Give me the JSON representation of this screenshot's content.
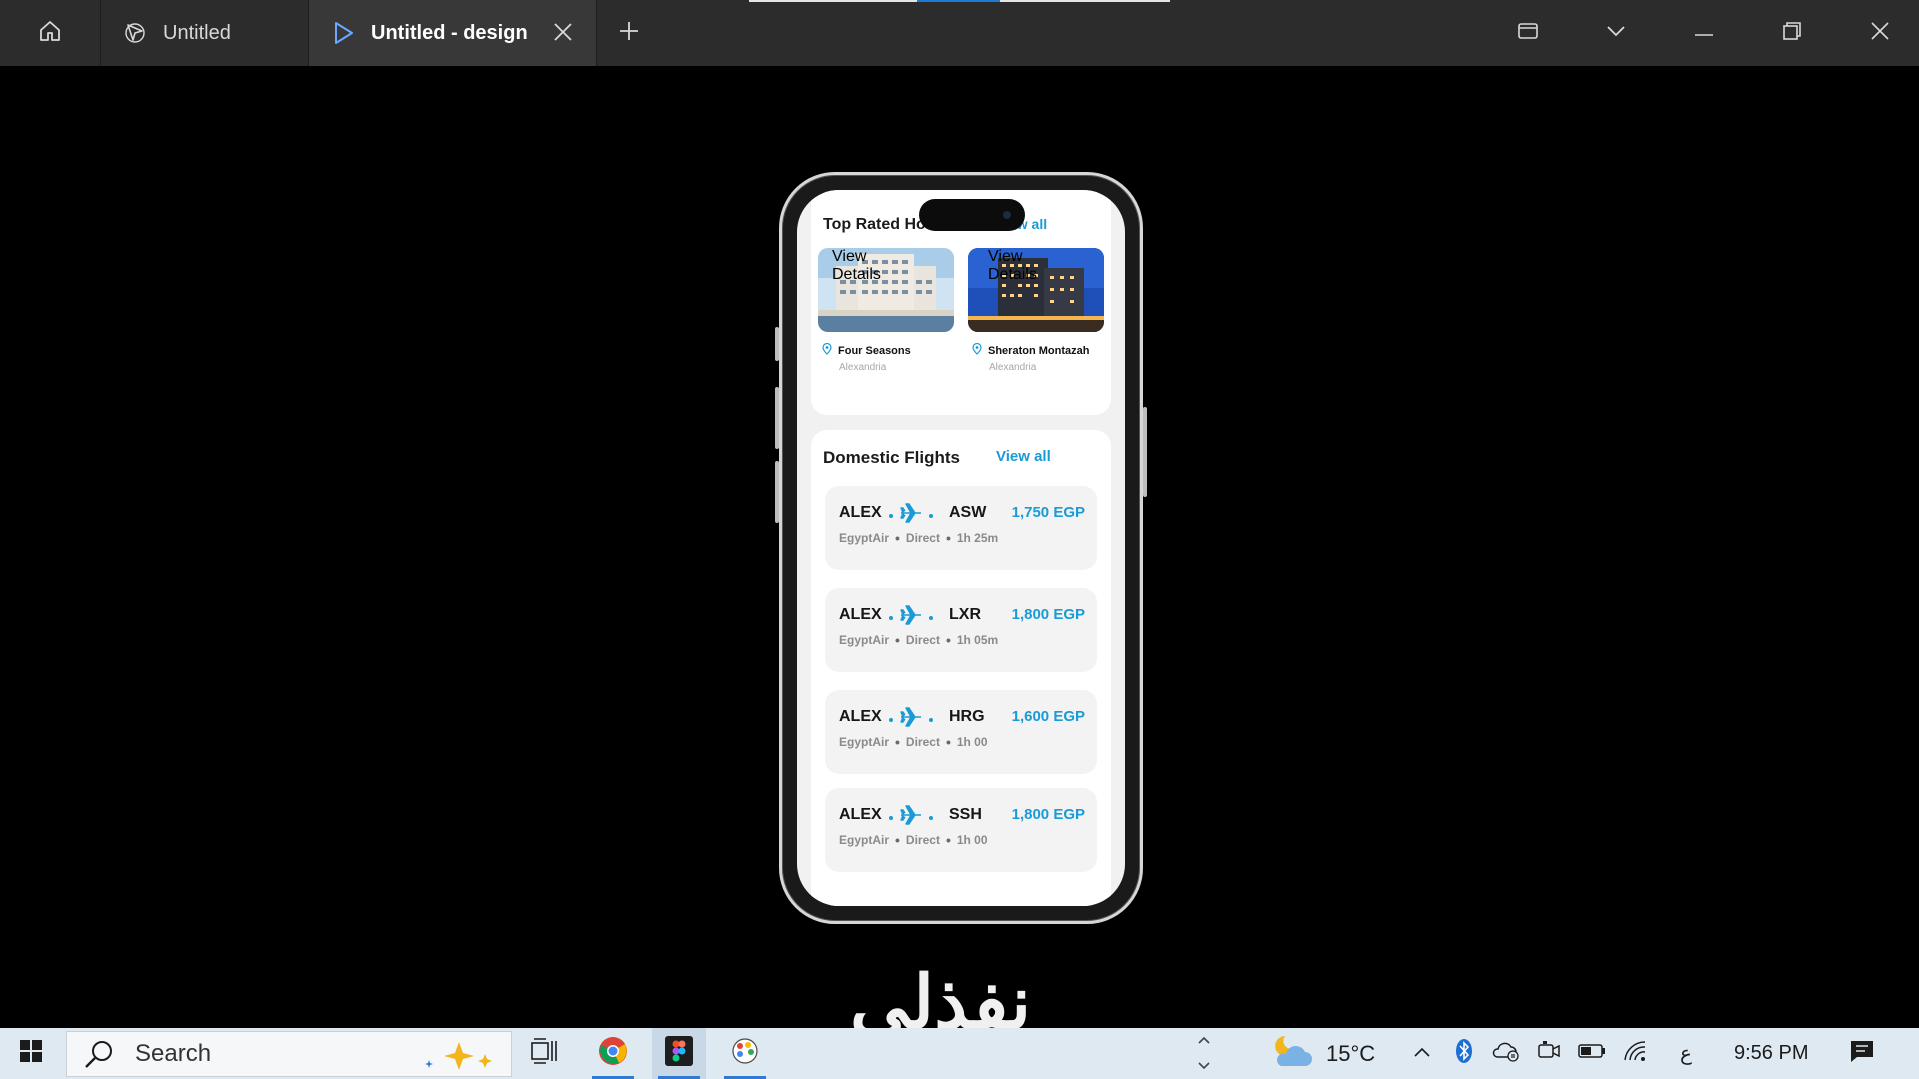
{
  "titlebar": {
    "tabs": [
      {
        "label": "Untitled",
        "icon": "figma-file-icon"
      },
      {
        "label": "Untitled - design",
        "icon": "play-icon",
        "active": true
      }
    ],
    "accent": "#1f7ad6"
  },
  "app": {
    "hotels_section": {
      "title": "Top Rated  Hotels",
      "view_all": "View all",
      "items": [
        {
          "name": "Four Seasons",
          "city": "Alexandria",
          "button": "View Details"
        },
        {
          "name": "Sheraton Montazah",
          "city": "Alexandria",
          "button": "View Details"
        }
      ]
    },
    "flights_section": {
      "title": "Domestic Flights",
      "view_all": "View all",
      "items": [
        {
          "from": "ALEX",
          "to": "ASW",
          "price": "1,750 EGP",
          "airline": "EgyptAir",
          "type": "Direct",
          "duration": "1h 25m"
        },
        {
          "from": "ALEX",
          "to": "LXR",
          "price": "1,800 EGP",
          "airline": "EgyptAir",
          "type": "Direct",
          "duration": "1h 05m"
        },
        {
          "from": "ALEX",
          "to": "HRG",
          "price": "1,600 EGP",
          "airline": "EgyptAir",
          "type": "Direct",
          "duration": "1h 00"
        },
        {
          "from": "ALEX",
          "to": "SSH",
          "price": "1,800 EGP",
          "airline": "EgyptAir",
          "type": "Direct",
          "duration": "1h 00"
        }
      ],
      "accent": "#1a9bd7"
    }
  },
  "watermark": "نفذلى",
  "taskbar": {
    "search_placeholder": "Search",
    "temperature": "15°C",
    "language": "ع",
    "time": "9:56 PM"
  }
}
